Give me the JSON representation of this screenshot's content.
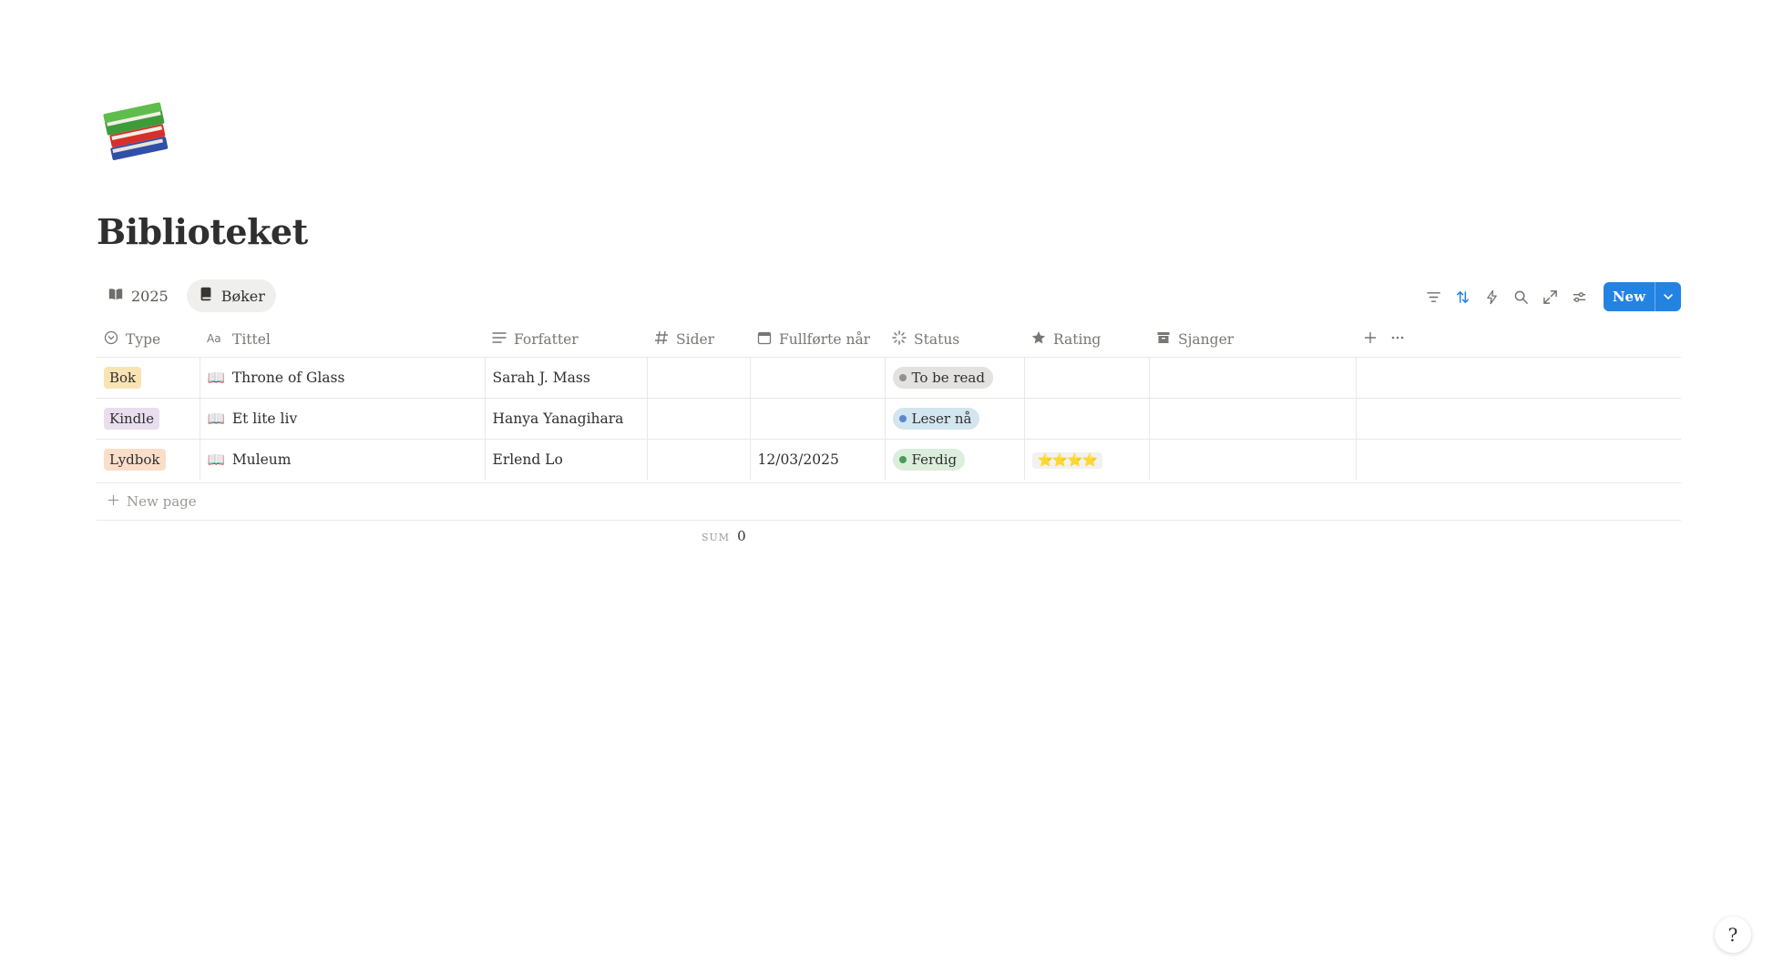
{
  "page": {
    "icon": "books-icon",
    "title": "Biblioteket"
  },
  "views": [
    {
      "label": "2025",
      "icon": "open-book-icon",
      "active": false
    },
    {
      "label": "Bøker",
      "icon": "book-icon",
      "active": true
    }
  ],
  "toolbar": {
    "icons": [
      "filter-icon",
      "sort-icon",
      "lightning-icon",
      "search-icon",
      "expand-icon",
      "settings-icon"
    ],
    "new_label": "New"
  },
  "table": {
    "columns": [
      {
        "label": "Type",
        "icon": "select-icon"
      },
      {
        "label": "Tittel",
        "icon": "text-icon"
      },
      {
        "label": "Forfatter",
        "icon": "lines-icon"
      },
      {
        "label": "Sider",
        "icon": "hash-icon"
      },
      {
        "label": "Fullførte når",
        "icon": "calendar-icon"
      },
      {
        "label": "Status",
        "icon": "status-icon"
      },
      {
        "label": "Rating",
        "icon": "star-icon"
      },
      {
        "label": "Sjanger",
        "icon": "archive-icon"
      }
    ],
    "rows": [
      {
        "type": "Bok",
        "type_color": "#fae3b3",
        "title": "Throne of Glass",
        "title_icon": "📖",
        "author": "Sarah J. Mass",
        "pages": "",
        "finished": "",
        "status": "To be read",
        "status_bg": "#e3e2e0",
        "status_dot": "#91918e",
        "rating": "",
        "genre": ""
      },
      {
        "type": "Kindle",
        "type_color": "#e8deee",
        "title": "Et lite liv",
        "title_icon": "📖",
        "author": "Hanya Yanagihara",
        "pages": "",
        "finished": "",
        "status": "Leser nå",
        "status_bg": "#d3e5ef",
        "status_dot": "#5e87c9",
        "rating": "",
        "genre": ""
      },
      {
        "type": "Lydbok",
        "type_color": "#fadec9",
        "title": "Muleum",
        "title_icon": "📖",
        "author": "Erlend Lo",
        "pages": "",
        "finished": "12/03/2025",
        "status": "Ferdig",
        "status_bg": "#dbeddb",
        "status_dot": "#4a9a5b",
        "rating": "⭐⭐⭐⭐",
        "genre": ""
      }
    ],
    "add_property_icon": "plus-icon",
    "more_icon": "ellipsis-icon"
  },
  "new_page_label": "New page",
  "sum": {
    "label": "SUM",
    "value": "0"
  },
  "help": {
    "icon": "help-icon",
    "glyph": "?"
  }
}
